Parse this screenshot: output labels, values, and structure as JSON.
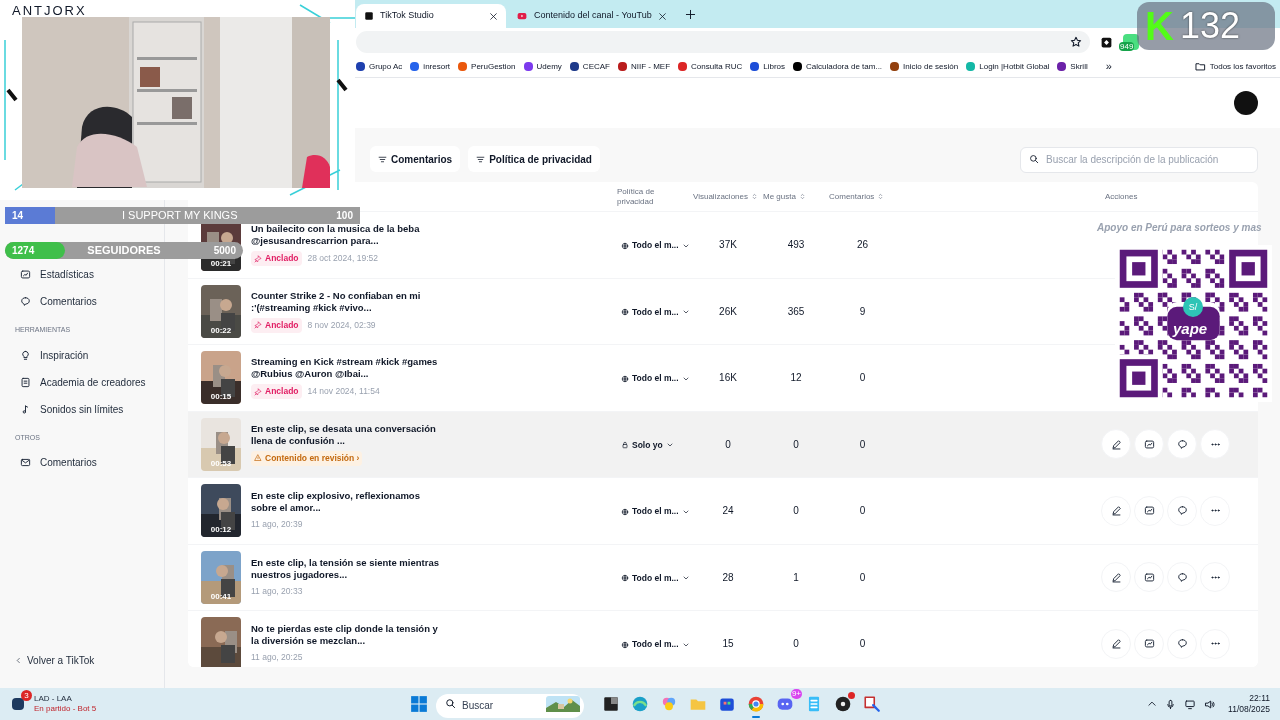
{
  "stream_overlay": {
    "channel_name": "ANTJORX",
    "goals": [
      {
        "kind": "support",
        "count": "14",
        "label": "I SUPPORT MY KINGS",
        "target": "100",
        "level": 0.14
      },
      {
        "kind": "followers",
        "count": "1274",
        "label": "SEGUIDORES",
        "target": "5000",
        "level": 0.25
      }
    ],
    "kick_widget": {
      "logo": "K",
      "count": "132"
    },
    "donation_note": "Apoyo en Perú para sorteos y mas",
    "qr_code": {
      "badge": "S/",
      "brand": "yape"
    }
  },
  "browser": {
    "tabs": [
      {
        "title": "TikTok Studio",
        "selected": true
      },
      {
        "title": "Contenido del canal - YouTub",
        "selected": false
      }
    ],
    "extension_badge": "949",
    "bookmarks": [
      {
        "label": "Grupo Ac",
        "color": "#1e40af"
      },
      {
        "label": "inresort",
        "color": "#2563eb"
      },
      {
        "label": "PeruGestion",
        "color": "#ea580c"
      },
      {
        "label": "Udemy",
        "color": "#7c3aed"
      },
      {
        "label": "CECAF",
        "color": "#1e3a8a"
      },
      {
        "label": "NIIF - MEF",
        "color": "#b91c1c"
      },
      {
        "label": "Consulta RUC",
        "color": "#dc2626"
      },
      {
        "label": "Libros",
        "color": "#1d4ed8"
      },
      {
        "label": "Calculadora de tam...",
        "color": "#000000"
      },
      {
        "label": "Inicio de sesión",
        "color": "#92400e"
      },
      {
        "label": "Login |Hotbit Global",
        "color": "#14b8a6"
      },
      {
        "label": "Skrill",
        "color": "#6b21a8"
      }
    ],
    "bookmarks_more": "»",
    "all_bookmarks": "Todos los favoritos"
  },
  "sidebar": {
    "sections": [
      {
        "items": [
          {
            "label": "Estadísticas",
            "kind": "stats"
          },
          {
            "label": "Comentarios",
            "kind": "comments"
          }
        ]
      },
      {
        "heading": "HERRAMIENTAS",
        "items": [
          {
            "label": "Inspiración",
            "kind": "idea"
          },
          {
            "label": "Academia de creadores",
            "kind": "academy"
          },
          {
            "label": "Sonidos sin límites",
            "kind": "sound"
          }
        ]
      },
      {
        "heading": "OTROS",
        "items": [
          {
            "label": "Comentarios",
            "kind": "mail"
          }
        ]
      }
    ],
    "back_link": "Volver a TikTok"
  },
  "filters": [
    "Comentarios",
    "Política de privacidad"
  ],
  "search": {
    "placeholder": "Buscar la descripción de la publicación"
  },
  "table": {
    "columns": [
      {
        "label": "Política de privacidad",
        "sortable": false
      },
      {
        "label": "Visualizaciones",
        "sortable": true
      },
      {
        "label": "Me gusta",
        "sortable": true
      },
      {
        "label": "Comentarios",
        "sortable": true
      },
      {
        "label": "Acciones",
        "sortable": false
      }
    ],
    "rows": [
      {
        "thumbnail": {
          "kind": "picture",
          "duration": "00:21"
        },
        "title": "Un bailecito con la musica de la beba @jesusandrescarrion para...",
        "badge": {
          "kind": "pinned",
          "label": "Anclado"
        },
        "date": "28 oct 2024, 19:52",
        "privacy": {
          "kind": "public",
          "label": "Todo el m..."
        },
        "views": "37K",
        "likes": "493",
        "comments": "26",
        "hovered": false,
        "actions_visible": false
      },
      {
        "thumbnail": {
          "kind": "picture",
          "duration": "00:22"
        },
        "title": "Counter Strike 2 - No confiaban en mi :'(#streaming #kick #vivo...",
        "badge": {
          "kind": "pinned",
          "label": "Anclado"
        },
        "date": "8 nov 2024, 02:39",
        "privacy": {
          "kind": "public",
          "label": "Todo el m..."
        },
        "views": "26K",
        "likes": "365",
        "comments": "9",
        "hovered": false,
        "actions_visible": false
      },
      {
        "thumbnail": {
          "kind": "picture",
          "duration": "00:15"
        },
        "title": "Streaming en Kick #stream #kick #games @Rubius @Auron @Ibai...",
        "badge": {
          "kind": "pinned",
          "label": "Anclado"
        },
        "date": "14 nov 2024, 11:54",
        "privacy": {
          "kind": "public",
          "label": "Todo el m..."
        },
        "views": "16K",
        "likes": "12",
        "comments": "0",
        "hovered": false,
        "actions_visible": false
      },
      {
        "thumbnail": {
          "kind": "picture",
          "duration": "00:53"
        },
        "title": "En este clip, se desata una conversación llena de confusión ...",
        "badge": {
          "kind": "review",
          "label": "Contenido en revisión ›"
        },
        "privacy": {
          "kind": "private",
          "label": "Solo yo"
        },
        "views": "0",
        "likes": "0",
        "comments": "0",
        "hovered": true,
        "actions_visible": true
      },
      {
        "thumbnail": {
          "kind": "picture",
          "duration": "00:12"
        },
        "title": "En este clip explosivo, reflexionamos sobre el amor...",
        "date": "11 ago, 20:39",
        "privacy": {
          "kind": "public",
          "label": "Todo el m..."
        },
        "views": "24",
        "likes": "0",
        "comments": "0",
        "hovered": false,
        "actions_visible": true
      },
      {
        "thumbnail": {
          "kind": "picture",
          "duration": "00:41"
        },
        "title": "En este clip, la tensión se siente mientras nuestros jugadores...",
        "date": "11 ago, 20:33",
        "privacy": {
          "kind": "public",
          "label": "Todo el m..."
        },
        "views": "28",
        "likes": "1",
        "comments": "0",
        "hovered": false,
        "actions_visible": true
      },
      {
        "title": "No te pierdas este clip donde la tensión y la diversión se mezclan...",
        "date": "11 ago, 20:25",
        "privacy": {
          "kind": "public",
          "label": "Todo el m..."
        },
        "views": "15",
        "likes": "0",
        "comments": "0",
        "hovered": false,
        "actions_visible": true
      }
    ]
  },
  "taskbar": {
    "notification": {
      "badge": "3",
      "title": "LAD - LAA",
      "subtitle": "En partido - Bot 5"
    },
    "search": {
      "placeholder": "Buscar"
    },
    "apps": [
      {
        "kind": "tasks"
      },
      {
        "kind": "wave"
      },
      {
        "kind": "flower"
      },
      {
        "kind": "folder"
      },
      {
        "kind": "store"
      },
      {
        "kind": "browser",
        "running": true
      },
      {
        "kind": "chat",
        "badge": "9+"
      },
      {
        "kind": "notes"
      },
      {
        "kind": "disc",
        "alert": true
      },
      {
        "kind": "tool"
      }
    ],
    "time": "22:11",
    "date": "11/08/2025"
  }
}
